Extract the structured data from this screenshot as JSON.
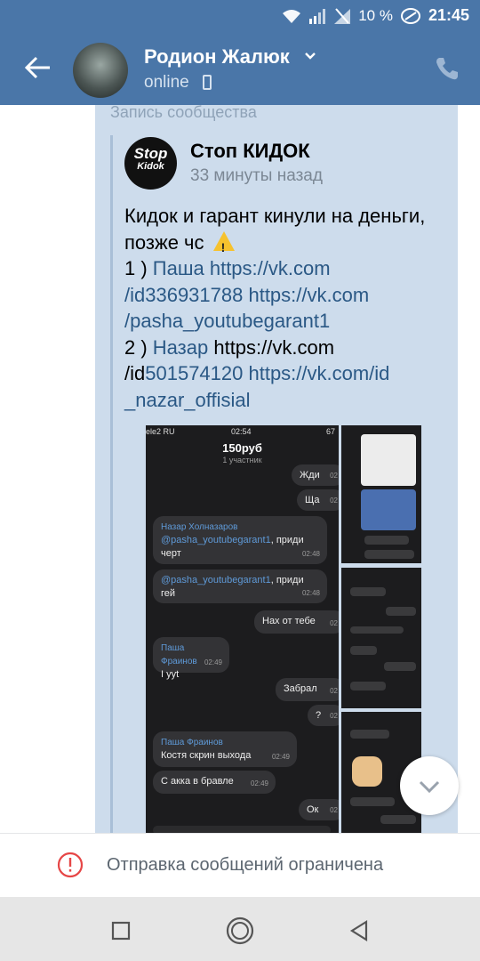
{
  "status_bar": {
    "battery": "10 %",
    "time": "21:45"
  },
  "header": {
    "name": "Родион Жалюк",
    "status": "online"
  },
  "message": {
    "repost_label": "Запись сообщества",
    "group_name": "Стоп КИДОК",
    "group_avatar_text": [
      "Stop",
      "Kidok"
    ],
    "time": "33 минуты назад",
    "text": {
      "line1": "Кидок и гарант кинули на деньги,",
      "line2": "позже чс",
      "l3_prefix": "1 ) ",
      "l3_link_name": "Паша",
      "l3_link_url": " https://vk.com",
      "l4": "/id336931788 https://vk.com",
      "l5": "/pasha_youtubegarant1",
      "l6_prefix": "2 ) ",
      "l6_link_name": "Назар",
      "l6_rest": " https://vk.com",
      "l7_prefix": "/id",
      "l7_link": "501574120 https://vk.com/id",
      "l8": "_nazar_offisial"
    }
  },
  "attachment": {
    "status_left": "ele2 RU",
    "status_time": "02:54",
    "status_right": "67",
    "chat_title": "150руб",
    "chat_sub": "1 участник",
    "messages": [
      {
        "text": "Жди",
        "time": "02"
      },
      {
        "text": "Ща",
        "time": "02"
      },
      {
        "name": "Назар Холназаров",
        "tag": "@pasha_youtubegarant1",
        "text": ", приди черт",
        "time": "02:48"
      },
      {
        "tag": "@pasha_youtubegarant1",
        "text": ", приди гей",
        "time": "02:48"
      },
      {
        "text": "Нах от тебе",
        "time": "02"
      },
      {
        "name": "Паша Фраинов",
        "text": "I yyt",
        "time": "02:49"
      },
      {
        "text": "Забрал",
        "time": "02"
      },
      {
        "text": "?",
        "time": "02"
      },
      {
        "name": "Паша Фраинов",
        "text": "Костя скрин выхода",
        "time": "02:49"
      },
      {
        "text": "С акка в бравле",
        "time": "02:49"
      },
      {
        "text": "Ок",
        "time": "02"
      }
    ]
  },
  "restricted": {
    "text": "Отправка сообщений ограничена"
  },
  "colors": {
    "header_bg": "#4a76a8",
    "bubble_bg": "#cddcec",
    "link": "#2a5885"
  }
}
